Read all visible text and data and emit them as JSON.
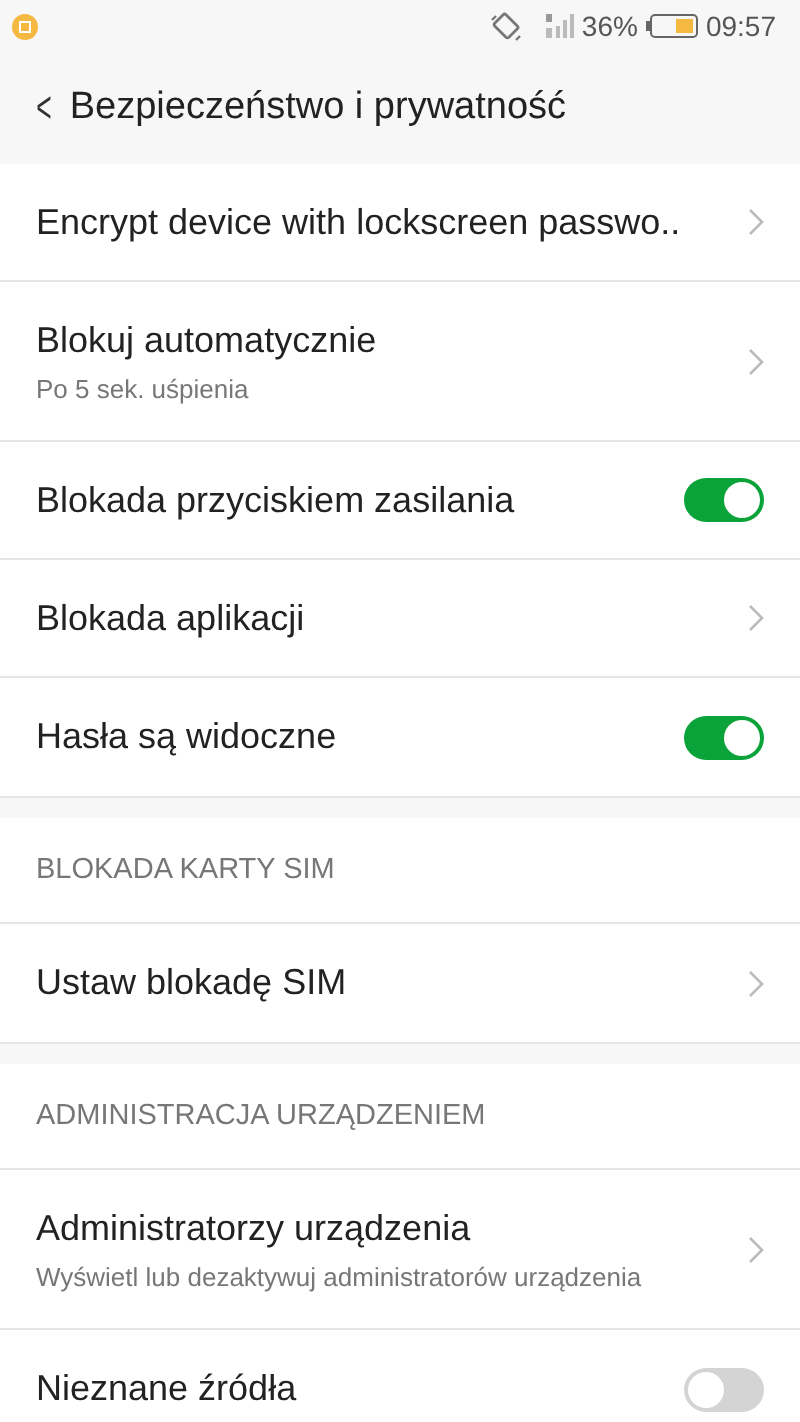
{
  "status_bar": {
    "battery_percent": "36%",
    "time": "09:57"
  },
  "header": {
    "back": "<",
    "title": "Bezpieczeństwo i prywatność"
  },
  "sections": [
    {
      "items": [
        {
          "kind": "link",
          "title": "Encrypt device with lockscreen passwo.."
        },
        {
          "kind": "link",
          "title": "Blokuj automatycznie",
          "subtitle": "Po 5 sek. uśpienia"
        },
        {
          "kind": "toggle",
          "title": "Blokada przyciskiem zasilania",
          "on": true
        },
        {
          "kind": "link",
          "title": "Blokada aplikacji"
        },
        {
          "kind": "toggle",
          "title": "Hasła są widoczne",
          "on": true
        }
      ]
    },
    {
      "heading": "BLOKADA KARTY SIM",
      "items": [
        {
          "kind": "link",
          "title": "Ustaw blokadę SIM"
        }
      ]
    },
    {
      "heading": "ADMINISTRACJA URZĄDZENIEM",
      "items": [
        {
          "kind": "link",
          "title": "Administratorzy urządzenia",
          "subtitle": "Wyświetl lub dezaktywuj administratorów urządzenia"
        },
        {
          "kind": "toggle",
          "title": "Nieznane źródła",
          "on": false
        }
      ]
    }
  ]
}
